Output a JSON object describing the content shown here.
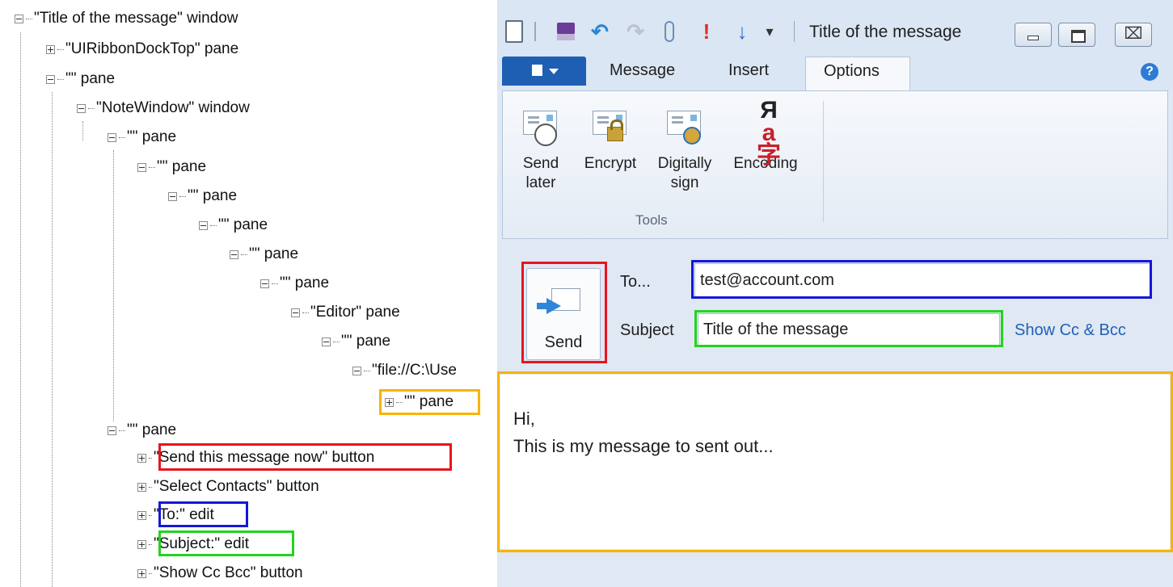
{
  "tree": {
    "nodes": [
      {
        "label": "\"Title of the message\" window",
        "expander": "minus"
      },
      {
        "label": "\"UIRibbonDockTop\" pane",
        "expander": "plus"
      },
      {
        "label": "\"\" pane",
        "expander": "minus"
      },
      {
        "label": "\"NoteWindow\" window",
        "expander": "minus"
      },
      {
        "label": "\"\" pane",
        "expander": "minus"
      },
      {
        "label": "\"\" pane",
        "expander": "minus"
      },
      {
        "label": "\"\" pane",
        "expander": "minus"
      },
      {
        "label": "\"\" pane",
        "expander": "minus"
      },
      {
        "label": "\"\" pane",
        "expander": "minus"
      },
      {
        "label": "\"\" pane",
        "expander": "minus"
      },
      {
        "label": "\"Editor\" pane",
        "expander": "minus"
      },
      {
        "label": "\"\" pane",
        "expander": "minus"
      },
      {
        "label": "\"file://C:\\Use",
        "expander": "minus"
      },
      {
        "label": "\"\" pane",
        "expander": "plus"
      },
      {
        "label": "\"\" pane",
        "expander": "minus"
      },
      {
        "label": "\"Send this message now\" button",
        "expander": "plus"
      },
      {
        "label": "\"Select Contacts\" button",
        "expander": "plus"
      },
      {
        "label": "\"To:\" edit",
        "expander": "plus"
      },
      {
        "label": "\"Subject:\" edit",
        "expander": "plus"
      },
      {
        "label": "\"Show Cc  Bcc\" button",
        "expander": "plus"
      }
    ]
  },
  "window": {
    "title": "Title of the message",
    "quick_access_icons": [
      "new-item-icon",
      "save-icon",
      "undo-icon",
      "redo-icon",
      "attach-icon",
      "high-importance-icon",
      "low-importance-icon",
      "customize-dropdown-icon"
    ],
    "controls": [
      "minimize-icon",
      "maximize-icon",
      "close-icon"
    ],
    "close_glyph": "⌧",
    "accent": "#1e5fb4"
  },
  "tabs": {
    "message": "Message",
    "insert": "Insert",
    "options": "Options"
  },
  "ribbon": {
    "send_later": [
      "Send",
      "later"
    ],
    "encrypt": "Encrypt",
    "digitally_sign": [
      "Digitally",
      "sign"
    ],
    "encoding": "Encoding",
    "group_label": "Tools",
    "encoding_glyphs": {
      "top": "Я",
      "bottom": "a字"
    }
  },
  "compose": {
    "send_label": "Send",
    "to_label": "To...",
    "to_value": "test@account.com",
    "subject_label": "Subject",
    "subject_value": "Title of the message",
    "show_cc_bcc": "Show Cc & Bcc",
    "body_lines": [
      "Hi,",
      "This is my message to sent out..."
    ]
  },
  "highlight_colors": {
    "send": "#e8141e",
    "to": "#1616d8",
    "subject": "#22d322",
    "body": "#f8b400"
  }
}
